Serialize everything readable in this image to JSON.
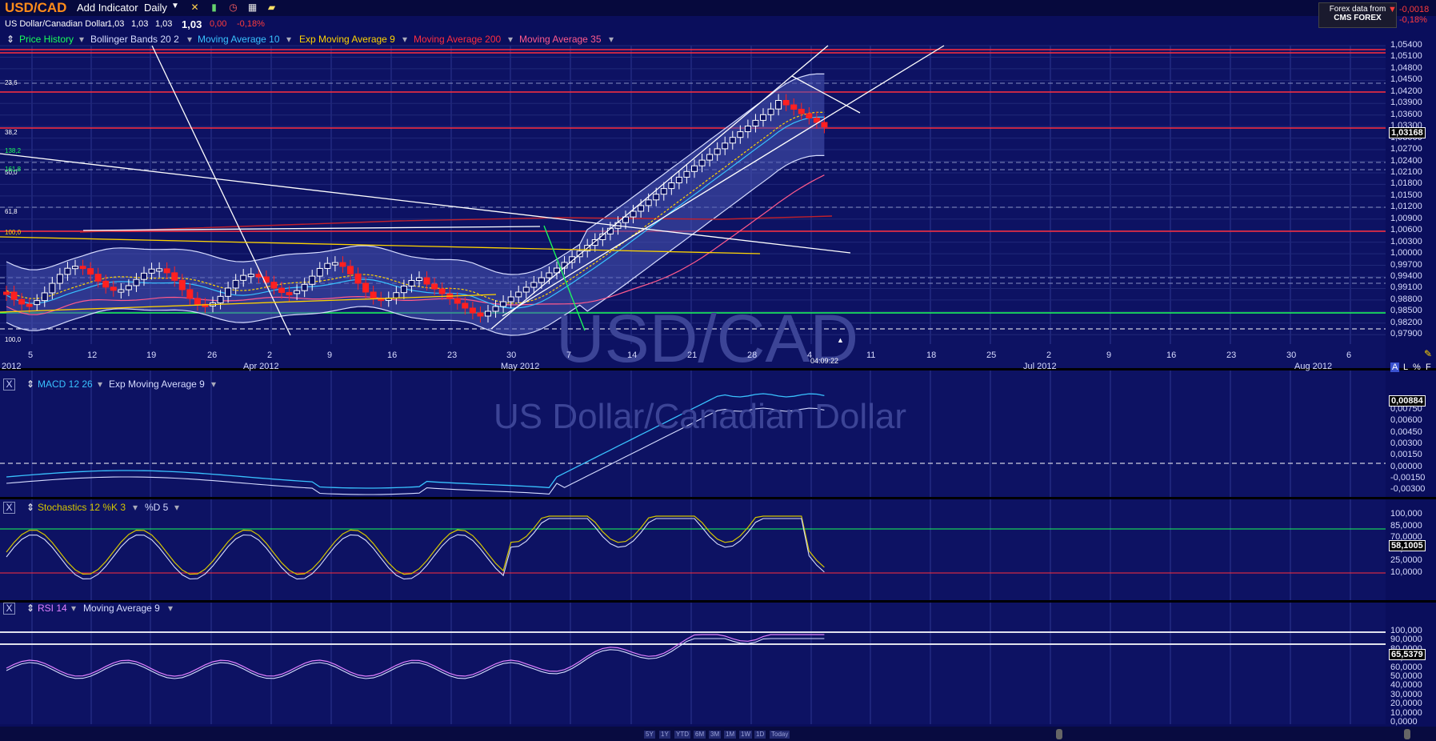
{
  "header": {
    "symbol": "USD/CAD",
    "add_indicator": "Add Indicator",
    "interval": "Daily",
    "name": "US Dollar/Canadian Dollar",
    "open": "1,03",
    "high": "1,03",
    "low": "1,03",
    "last": "1,03",
    "change": "0,00",
    "change_pct": "-0,18%"
  },
  "brand": {
    "line1": "Forex data from",
    "line2": "CMS FOREX"
  },
  "top_right_change": {
    "value": "-0,0018",
    "pct": "-0,18%"
  },
  "legend": {
    "price_history": "Price History",
    "bollinger": "Bollinger Bands 20 2",
    "ma10": "Moving Average 10",
    "ema9": "Exp Moving Average 9",
    "ma200": "Moving Average 200",
    "ma35": "Moving Average 35"
  },
  "colors": {
    "background": "#0a0e5c",
    "up_candle": "#ffffff",
    "down_candle": "#ff2020",
    "price_history": "#19ff5a",
    "bollinger": "#d6dcff",
    "ma10": "#39c2ff",
    "ema9": "#ffd400",
    "ma200": "#ff2d3d",
    "ma35": "#ff5a8c",
    "macd": "#39c2ff",
    "stoch_k": "#d5c600",
    "rsi": "#e080ff"
  },
  "price_axis": [
    "1,05400",
    "1,05100",
    "1,04800",
    "1,04500",
    "1,04200",
    "1,03900",
    "1,03600",
    "1,03300",
    "1,03000",
    "1,02700",
    "1,02400",
    "1,02100",
    "1,01800",
    "1,01500",
    "1,01200",
    "1,00900",
    "1,00600",
    "1,00300",
    "1,00000",
    "0,99700",
    "0,99400",
    "0,99100",
    "0,98800",
    "0,98500",
    "0,98200",
    "0,97900"
  ],
  "current_price": "1,03168",
  "fib_labels": [
    "23,6",
    "38,2",
    "50,0",
    "61,8",
    "100,0",
    "100,0",
    "161,8",
    "138,2"
  ],
  "date_axis": [
    "5",
    "12",
    "19",
    "26",
    "2",
    "9",
    "16",
    "23",
    "30",
    "7",
    "14",
    "21",
    "28",
    "4",
    "11",
    "18",
    "25",
    "2",
    "9",
    "16",
    "23",
    "30",
    "6"
  ],
  "month_axis": [
    "2012",
    "Apr 2012",
    "May 2012",
    "Jul 2012",
    "Aug 2012"
  ],
  "time_marker": "04:09:22",
  "axis_mode": {
    "a": "A",
    "l": "L",
    "pct": "%",
    "f": "F"
  },
  "watermark": {
    "symbol": "USD/CAD",
    "name": "US Dollar/Canadian Dollar"
  },
  "macd_panel": {
    "label": "MACD 12 26",
    "signal": "Exp Moving Average 9",
    "value": "0,00884",
    "axis": [
      "0,00750",
      "0,00600",
      "0,00450",
      "0,00300",
      "0,00150",
      "0,00000",
      "-0,00150",
      "-0,00300"
    ]
  },
  "stoch_panel": {
    "label": "Stochastics 12 %K 3",
    "d": "%D 5",
    "value": "58,1005",
    "axis": [
      "100,000",
      "85,0000",
      "70,0000",
      "40,0000",
      "25,0000",
      "10,0000"
    ]
  },
  "rsi_panel": {
    "label": "RSI 14",
    "ma": "Moving Average 9",
    "value": "65,5379",
    "axis": [
      "100,000",
      "90,0000",
      "80,0000",
      "70,0000",
      "60,0000",
      "50,0000",
      "40,0000",
      "30,0000",
      "20,0000",
      "10,0000",
      "0,0000"
    ]
  },
  "timeframes": [
    "5Y",
    "1Y",
    "YTD",
    "6M",
    "3M",
    "1M",
    "1W",
    "1D",
    "Today"
  ]
}
